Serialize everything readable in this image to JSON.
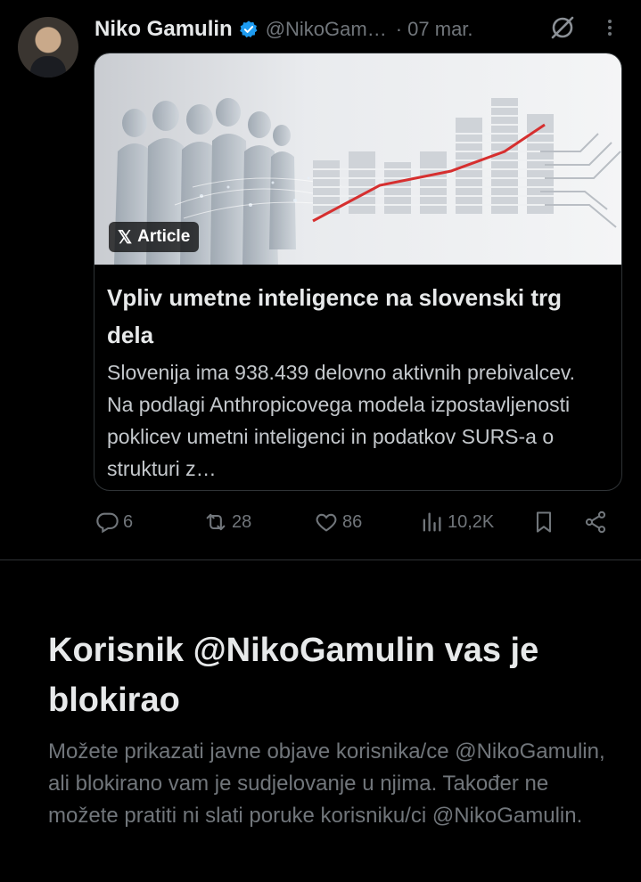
{
  "tweet": {
    "author_name": "Niko Gamulin",
    "handle": "@NikoGam…",
    "date": "· 07 mar.",
    "card": {
      "badge": "Article",
      "title": "Vpliv umetne inteligence na slovenski trg dela",
      "description": "Slovenija ima 938.439 delovno aktivnih prebivalcev. Na podlagi Anthropicovega modela izpostavljenosti poklicev umetni inteligenci in podatkov SURS-a o strukturi z…"
    },
    "actions": {
      "replies": "6",
      "reposts": "28",
      "likes": "86",
      "views": "10,2K"
    }
  },
  "blocked": {
    "title": "Korisnik @NikoGamulin vas je blokirao",
    "message": "Možete prikazati javne objave korisnika/ce @NikoGamulin, ali blokirano vam je sudjelovanje u njima. Također ne možete pratiti ni slati poruke korisniku/ci @NikoGamulin."
  },
  "colors": {
    "background": "#000000",
    "verified": "#1d9bf0",
    "muted": "#71767b",
    "chart_line": "#d62f2f"
  }
}
